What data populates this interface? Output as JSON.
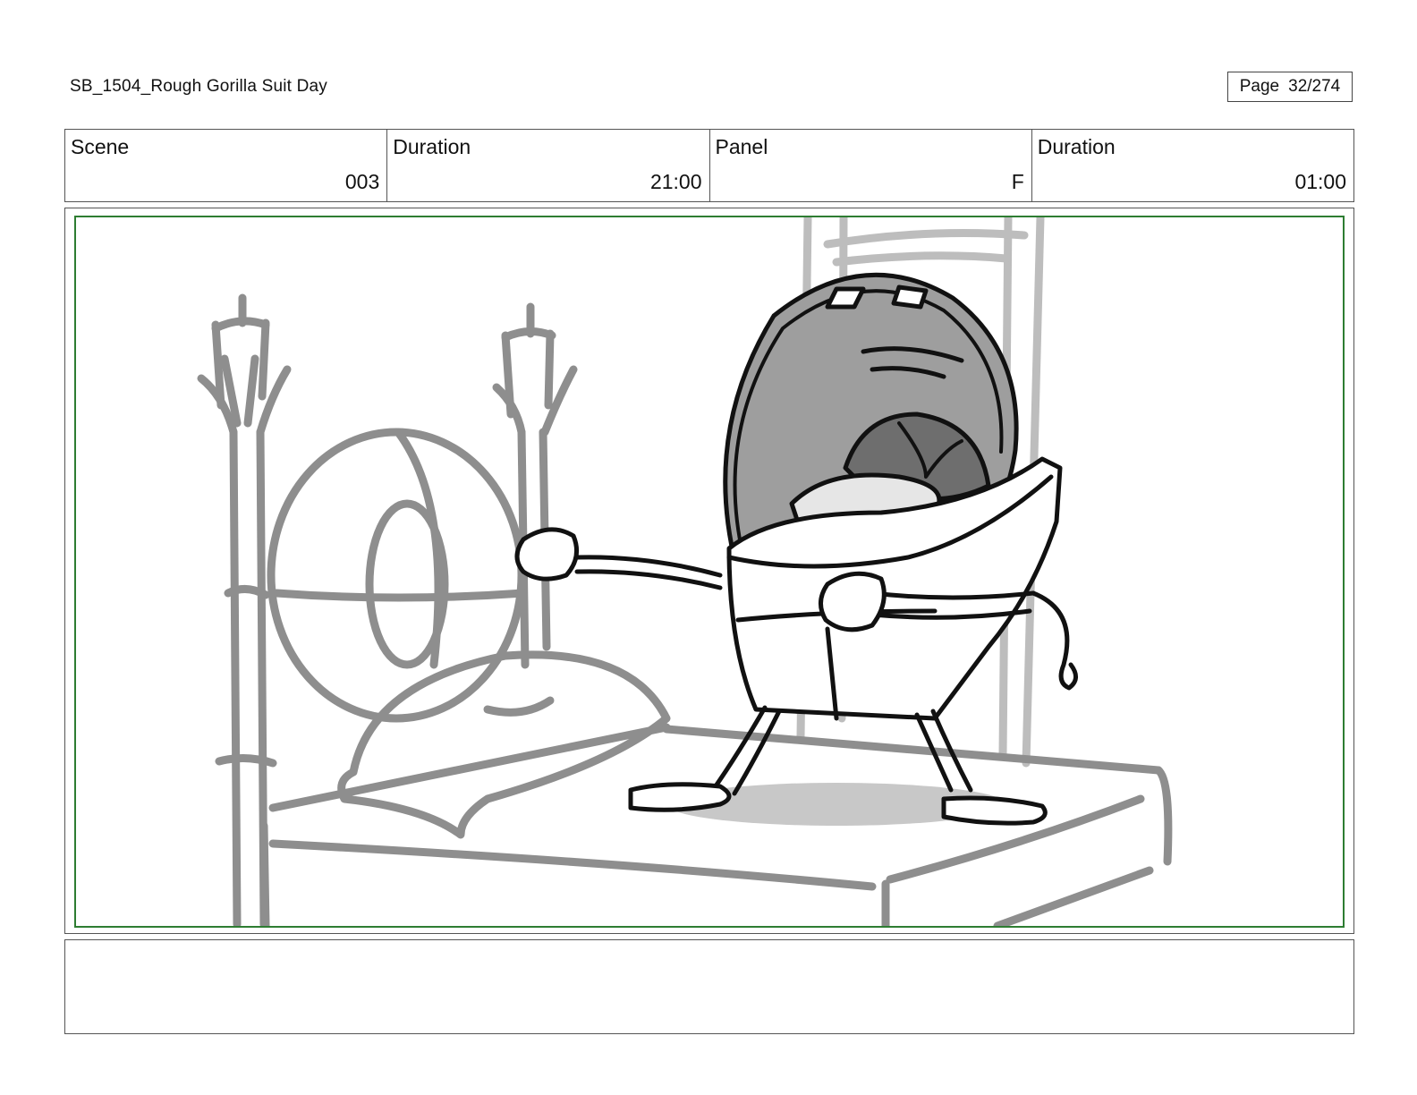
{
  "header": {
    "title": "SB_1504_Rough  Gorilla Suit Day",
    "page_label": "Page",
    "page_value": "32/274"
  },
  "info": [
    {
      "label": "Scene",
      "value": "003"
    },
    {
      "label": "Duration",
      "value": "21:00"
    },
    {
      "label": "Panel",
      "value": "F"
    },
    {
      "label": "Duration",
      "value": "01:00"
    }
  ],
  "frame": {
    "border_color": "#2e7d32"
  },
  "notes": {
    "text": ""
  }
}
